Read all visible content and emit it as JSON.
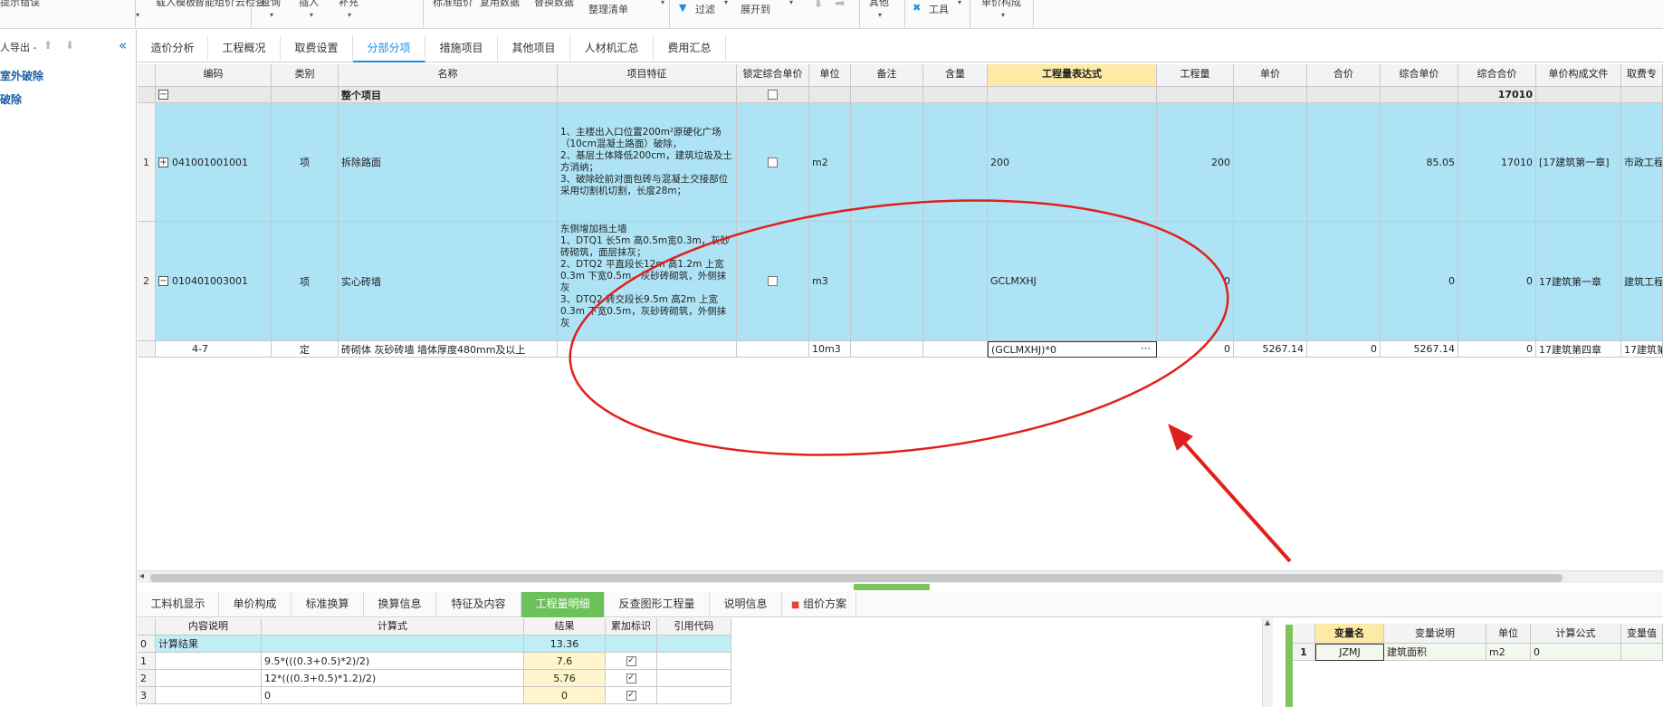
{
  "ribbon": {
    "items": [
      "人导出",
      "提示错误",
      "载入模板",
      "智能组价",
      "云检查",
      "查询",
      "插入",
      "补充",
      "标准组价",
      "复用数据",
      "替换数据",
      "整理清单",
      "过滤",
      "展开到",
      "其他",
      "工具",
      "单价构成"
    ]
  },
  "left": {
    "export_label": "人导出 -",
    "tree": [
      "室外破除",
      "破除"
    ]
  },
  "top_tabs": [
    "造价分析",
    "工程概况",
    "取费设置",
    "分部分项",
    "措施项目",
    "其他项目",
    "人材机汇总",
    "费用汇总"
  ],
  "active_top_tab": "分部分项",
  "grid": {
    "headers": [
      "编码",
      "类别",
      "名称",
      "项目特征",
      "锁定综合单价",
      "单位",
      "备注",
      "含量",
      "工程量表达式",
      "工程量",
      "单价",
      "合价",
      "综合单价",
      "综合合价",
      "单价构成文件",
      "取费专"
    ],
    "whole_row": {
      "name": "整个项目",
      "total": "17010"
    },
    "rows": [
      {
        "num": "1",
        "code": "041001001001",
        "type": "项",
        "name": "拆除路面",
        "feature": "1、主楼出入口位置200m²原硬化广场（10cm混凝土路面）破除，\n2、基层土体降低200cm，建筑垃圾及土方消纳；\n3、破除砼前对面包砖与混凝土交接部位采用切割机切割，长度28m；",
        "unit": "m2",
        "expr": "200",
        "qty": "200",
        "price": "",
        "sum": "",
        "unit_comp": "85.05",
        "total": "17010",
        "file": "[17建筑第一章]",
        "fee": "市政工程"
      },
      {
        "num": "2",
        "code": "010401003001",
        "type": "项",
        "name": "实心砖墙",
        "feature": "东侧增加挡土墙\n1、DTQ1 长5m 高0.5m宽0.3m，灰砂砖砌筑，面层抹灰；\n2、DTQ2 平直段长12m 高1.2m 上宽0.3m 下宽0.5m，灰砂砖砌筑，外侧抹灰\n3、DTQ2 转交段长9.5m 高2m 上宽0.3m 下宽0.5m，灰砂砖砌筑，外侧抹灰",
        "unit": "m3",
        "expr": "GCLMXHJ",
        "qty": "0",
        "price": "",
        "sum": "",
        "unit_comp": "0",
        "total": "0",
        "file": "17建筑第一章",
        "fee": "建筑工程"
      },
      {
        "num": "",
        "code": "4-7",
        "type": "定",
        "name": "砖砌体 灰砂砖墙 墙体厚度480mm及以上",
        "feature": "",
        "unit": "10m3",
        "expr": "(GCLMXHJ)*0",
        "qty": "0",
        "price": "5267.14",
        "sum": "0",
        "unit_comp": "5267.14",
        "total": "0",
        "file": "17建筑第四章",
        "fee": "17建筑第"
      }
    ]
  },
  "bottom_tabs": [
    "工料机显示",
    "单价构成",
    "标准换算",
    "换算信息",
    "特征及内容",
    "工程量明细",
    "反查图形工程量",
    "说明信息",
    "组价方案"
  ],
  "active_bottom_tab": "工程量明细",
  "detail": {
    "headers": [
      "内容说明",
      "计算式",
      "结果",
      "累加标识",
      "引用代码"
    ],
    "rows": [
      {
        "num": "0",
        "desc": "计算结果",
        "formula": "",
        "result": "13.36"
      },
      {
        "num": "1",
        "desc": "",
        "formula": "9.5*(((0.3+0.5)*2)/2)",
        "result": "7.6"
      },
      {
        "num": "2",
        "desc": "",
        "formula": "12*(((0.3+0.5)*1.2)/2)",
        "result": "5.76"
      },
      {
        "num": "3",
        "desc": "",
        "formula": "0",
        "result": "0"
      }
    ]
  },
  "variables": {
    "headers": [
      "变量名",
      "变量说明",
      "单位",
      "计算公式",
      "变量值"
    ],
    "rows": [
      {
        "num": "1",
        "name": "JZMJ",
        "desc": "建筑面积",
        "unit": "m2",
        "formula": "0",
        "value": ""
      }
    ]
  },
  "colors": {
    "accent": "#1a8de0",
    "row_highlight": "#aee3f5",
    "header_highlight": "#fdeaa6",
    "annotation": "#e0201b",
    "active_bottom_tab": "#6cc15a"
  }
}
